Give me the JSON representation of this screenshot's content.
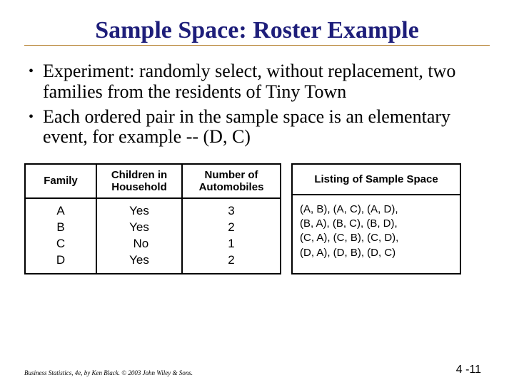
{
  "title": "Sample Space:  Roster Example",
  "bullets": [
    "Experiment:  randomly select, without replacement, two families from the residents of Tiny Town",
    "Each ordered pair in the sample space is an elementary event, for example -- (D, C)"
  ],
  "table": {
    "headers": {
      "c0": "Family",
      "c1": "Children in Household",
      "c2": "Number of Automobiles"
    },
    "rows": {
      "family": "A\nB\nC\nD",
      "children": "Yes\nYes\n No\nYes",
      "autos": "3\n2\n1\n2"
    }
  },
  "listing": {
    "header": "Listing of Sample Space",
    "lines": "(A, B), (A, C), (A, D),\n(B, A), (B, C), (B, D),\n(C, A), (C, B), (C, D),\n(D, A), (D, B), (D, C)"
  },
  "footer": {
    "left": "Business Statistics, 4e, by Ken Black. © 2003 John Wiley & Sons.",
    "right": "4 -11"
  }
}
